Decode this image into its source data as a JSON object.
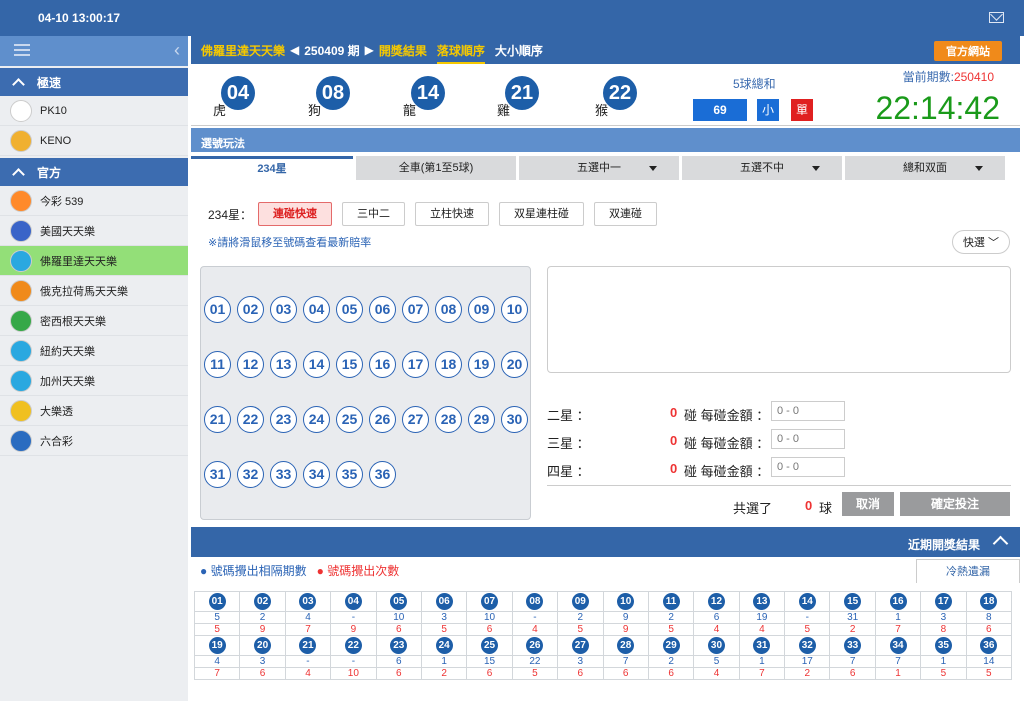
{
  "topbar": {
    "time": "04-10 13:00:17"
  },
  "sidebar": {
    "sections": [
      {
        "title": "極速",
        "items": [
          {
            "label": "PK10",
            "icon": "pk10-logo",
            "color": "#ffffff"
          },
          {
            "label": "KENO",
            "icon": "keno-logo",
            "color": "#f0b030"
          }
        ]
      },
      {
        "title": "官方",
        "items": [
          {
            "label": "今彩 539",
            "icon": "539-logo",
            "color": "#ff8a2a"
          },
          {
            "label": "美國天天樂",
            "icon": "us-flag-logo",
            "color": "#3a64c8"
          },
          {
            "label": "佛羅里達天天樂",
            "icon": "florida-logo",
            "color": "#2aa8e0"
          },
          {
            "label": "俄克拉荷馬天天樂",
            "icon": "oklahoma-logo",
            "color": "#f08a1a"
          },
          {
            "label": "密西根天天樂",
            "icon": "michigan-logo",
            "color": "#36a848"
          },
          {
            "label": "紐約天天樂",
            "icon": "newyork-logo",
            "color": "#2aa8e0"
          },
          {
            "label": "加州天天樂",
            "icon": "california-logo",
            "color": "#2aa8e0"
          },
          {
            "label": "大樂透",
            "icon": "lotto-logo",
            "color": "#f0c020"
          },
          {
            "label": "六合彩",
            "icon": "marksix-logo",
            "color": "#2a6cc0"
          }
        ]
      }
    ],
    "active": "佛羅里達天天樂"
  },
  "nav": {
    "game": "佛羅里達天天樂",
    "period": "250409 期",
    "results": "開獎結果",
    "order": "落球順序",
    "size": "大小順序",
    "official": "官方網站"
  },
  "draw": {
    "balls": [
      {
        "num": "04",
        "zodiac": "虎"
      },
      {
        "num": "08",
        "zodiac": "狗"
      },
      {
        "num": "14",
        "zodiac": "龍"
      },
      {
        "num": "21",
        "zodiac": "雞"
      },
      {
        "num": "22",
        "zodiac": "猴"
      }
    ],
    "sum_label": "5球總和",
    "sum": "69",
    "size": "小",
    "parity": "單",
    "current_label": "當前期數:",
    "current_period": "250410",
    "clock": "22:14:42"
  },
  "play": {
    "title": "選號玩法",
    "tabs": [
      "234星",
      "全車(第1至5球)",
      "五選中一",
      "五選不中",
      "總和双面"
    ],
    "sub_label": "234星：",
    "sub_buttons": [
      "連碰快速",
      "三中二",
      "立柱快速",
      "双星連柱碰",
      "双連碰"
    ],
    "hint": "※請將滑鼠移至號碼查看最新賠率",
    "quick": "快選",
    "numbers": [
      "01",
      "02",
      "03",
      "04",
      "05",
      "06",
      "07",
      "08",
      "09",
      "10",
      "11",
      "12",
      "13",
      "14",
      "15",
      "16",
      "17",
      "18",
      "19",
      "20",
      "21",
      "22",
      "23",
      "24",
      "25",
      "26",
      "27",
      "28",
      "29",
      "30",
      "31",
      "32",
      "33",
      "34",
      "35",
      "36"
    ],
    "stars": [
      {
        "name": "二星 ：",
        "count": "0",
        "label": "碰 每碰金額 ：",
        "value": "0 - 0"
      },
      {
        "name": "三星 ：",
        "count": "0",
        "label": "碰 每碰金額 ：",
        "value": "0 - 0"
      },
      {
        "name": "四星 ：",
        "count": "0",
        "label": "碰 每碰金額 ：",
        "value": "0 - 0"
      }
    ],
    "total_label": "共選了",
    "total_count": "0",
    "total_unit": "球",
    "cancel": "取消",
    "submit": "確定投注"
  },
  "recent": {
    "title": "近期開獎結果",
    "legend_gap": "號碼攪出相隔期數",
    "legend_count": "號碼攪出次數",
    "cold_hot": "冷熱遺漏",
    "row1": {
      "nums": [
        "01",
        "02",
        "03",
        "04",
        "05",
        "06",
        "07",
        "08",
        "09",
        "10",
        "11",
        "12",
        "13",
        "14",
        "15",
        "16",
        "17",
        "18"
      ],
      "gap": [
        "5",
        "2",
        "4",
        "-",
        "10",
        "3",
        "10",
        "-",
        "2",
        "9",
        "2",
        "6",
        "19",
        "-",
        "31",
        "1",
        "3",
        "8"
      ],
      "count": [
        "5",
        "9",
        "7",
        "9",
        "6",
        "5",
        "6",
        "4",
        "5",
        "9",
        "5",
        "4",
        "4",
        "5",
        "2",
        "7",
        "8",
        "6"
      ]
    },
    "row2": {
      "nums": [
        "19",
        "20",
        "21",
        "22",
        "23",
        "24",
        "25",
        "26",
        "27",
        "28",
        "29",
        "30",
        "31",
        "32",
        "33",
        "34",
        "35",
        "36"
      ],
      "gap": [
        "4",
        "3",
        "-",
        "-",
        "6",
        "1",
        "15",
        "22",
        "3",
        "7",
        "2",
        "5",
        "1",
        "17",
        "7",
        "7",
        "1",
        "14"
      ],
      "count": [
        "7",
        "6",
        "4",
        "10",
        "6",
        "2",
        "6",
        "5",
        "6",
        "6",
        "6",
        "4",
        "7",
        "2",
        "6",
        "1",
        "5",
        "5"
      ]
    }
  }
}
